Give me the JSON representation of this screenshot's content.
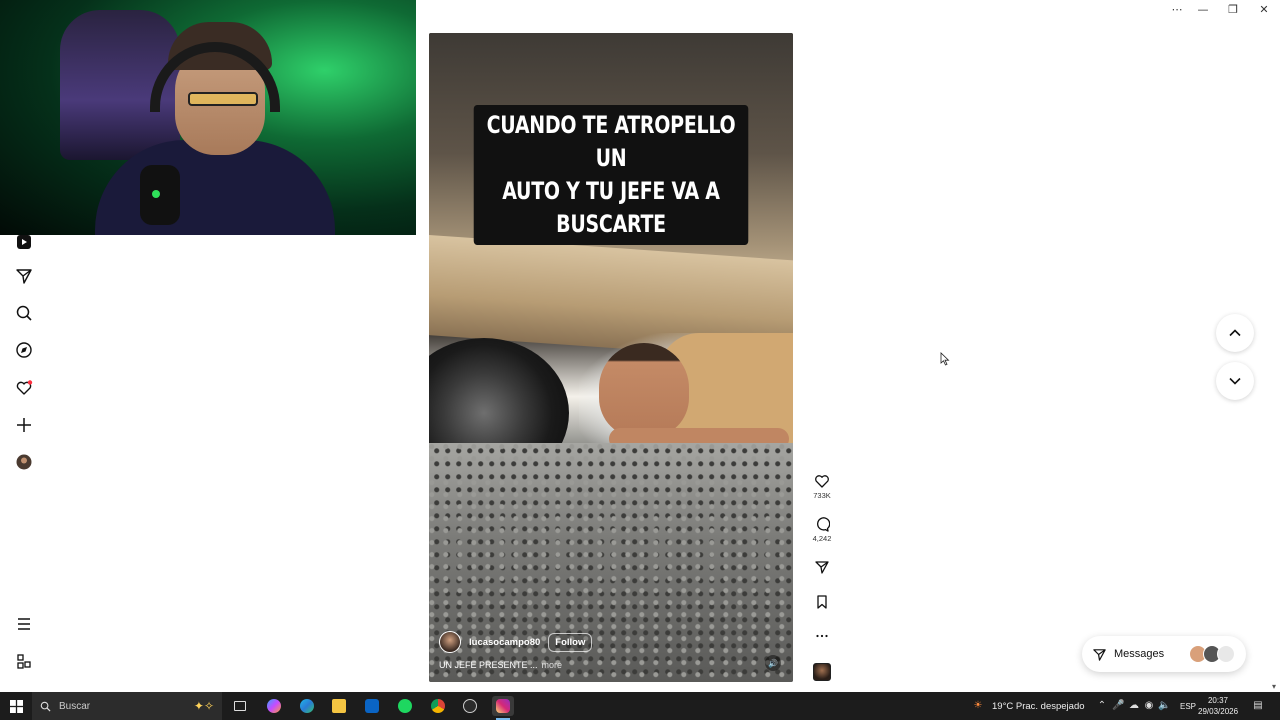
{
  "window": {
    "minimize_glyph": "—",
    "maximize_glyph": "❐",
    "close_glyph": "✕",
    "overflow_glyph": "⋯"
  },
  "nav": {
    "items": [
      {
        "name": "reels-icon"
      },
      {
        "name": "messages-icon"
      },
      {
        "name": "search-icon"
      },
      {
        "name": "explore-icon"
      },
      {
        "name": "notifications-icon"
      },
      {
        "name": "create-icon"
      },
      {
        "name": "profile-avatar"
      },
      {
        "name": "more-menu-icon"
      },
      {
        "name": "threads-icon"
      }
    ]
  },
  "reel": {
    "caption_line1": "CUANDO TE ATROPELLO UN",
    "caption_line2": "AUTO Y TU JEFE VA A BUSCARTE",
    "author": "lucasocampo80",
    "follow_label": "Follow",
    "text": "UN JEFE PRESENTE ...",
    "more_label": "more",
    "likes": "733K",
    "comments": "4,242"
  },
  "messages": {
    "label": "Messages"
  },
  "taskbar": {
    "search_placeholder": "Buscar",
    "weather": "19°C  Prac. despejado",
    "language": "ESP",
    "time": "20:37",
    "date": "29/03/2026"
  },
  "colors": {
    "notification_dot": "#ff3040",
    "taskbar_bg": "#1c1c1c",
    "accent": "#76b9ed"
  }
}
